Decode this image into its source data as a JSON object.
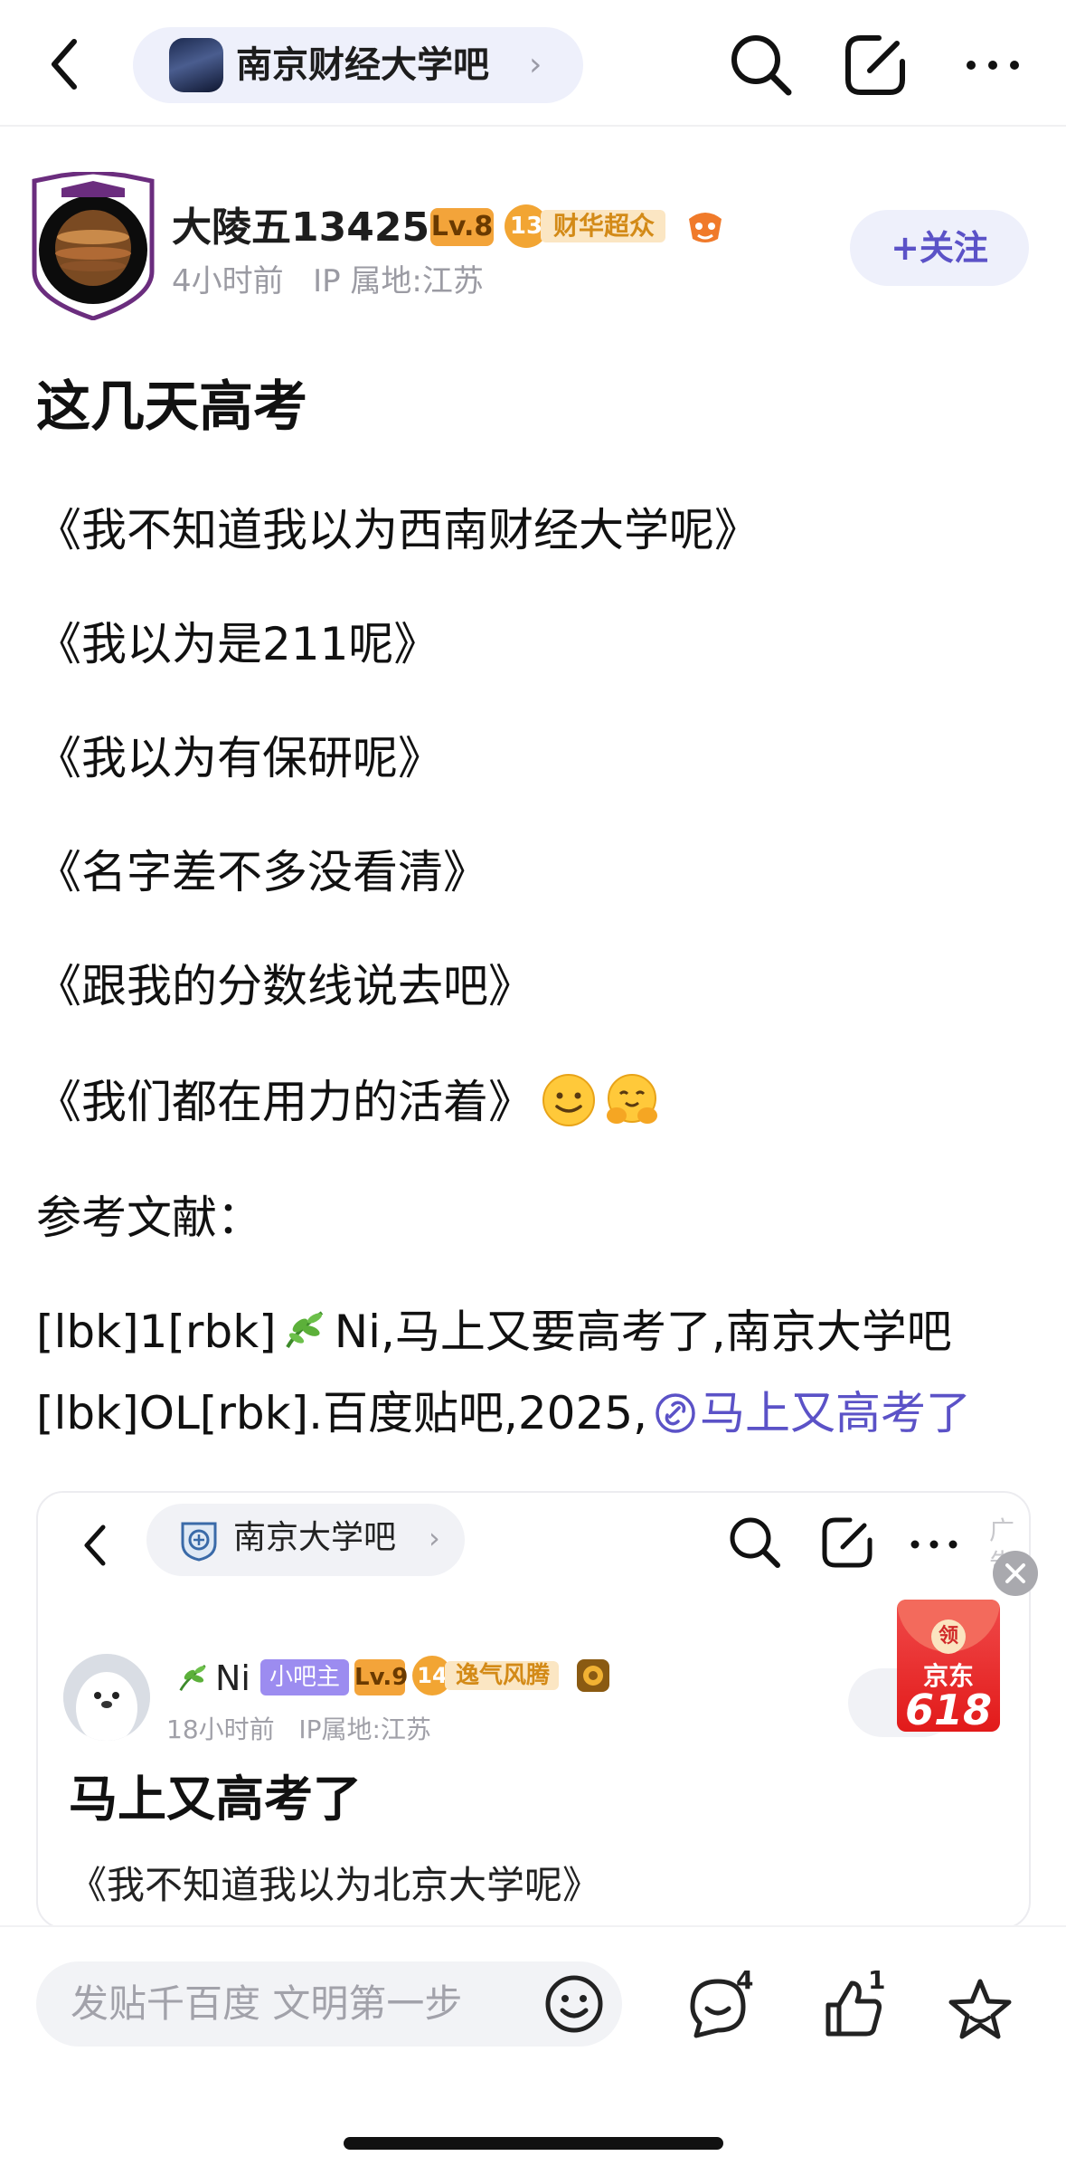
{
  "nav": {
    "forum_name": "南京财经大学吧",
    "chevron": "›"
  },
  "author": {
    "name": "大陵五13425",
    "level": "Lv.8",
    "medal_level": "13",
    "medal_title": "财华超众",
    "post_time": "4小时前",
    "ip_location": "IP 属地:江苏",
    "follow_label": "+关注"
  },
  "post": {
    "title": "这几天高考",
    "lines": [
      "《我不知道我以为西南财经大学呢》",
      "《我以为是211呢》",
      "《我以为有保研呢》",
      "《名字差不多没看清》",
      "《跟我的分数线说去吧》",
      "《我们都在用力的活着》"
    ],
    "references_heading": "参考文献：",
    "ref_line1_a": "[lbk]1[rbk]",
    "ref_line1_b": "Ni,马上又要高考了,南京大学吧",
    "ref_line2_a": "[lbk]OL[rbk].百度贴吧,2025,",
    "ref_link": "马上又高考了"
  },
  "embedded": {
    "forum_name": "南京大学吧",
    "chevron": "›",
    "ad_label": "广告",
    "author_name": "Ni",
    "moderator_tag": "小吧主",
    "level": "Lv.9",
    "medal_level": "14",
    "medal_title": "逸气风腾",
    "post_time": "18小时前",
    "ip_location": "IP属地:江苏",
    "title": "马上又高考了",
    "body_preview": "《我不知道我以为北京大学呢》"
  },
  "ad": {
    "coin": "领",
    "brand": "京东",
    "promo": "618"
  },
  "bottom": {
    "reply_placeholder": "发贴千百度 文明第一步",
    "comment_count": "4",
    "like_count": "1"
  },
  "colors": {
    "accent": "#5b52c7",
    "pill_bg": "#eef0fb",
    "level_badge": "#f3a43a",
    "medal_gold": "#f2a533",
    "ad_red": "#e21a1a"
  },
  "icons": [
    "back-arrow-icon",
    "search-icon",
    "edit-icon",
    "more-icon",
    "link-icon",
    "smiley-icon",
    "comment-icon",
    "like-icon",
    "star-icon",
    "close-icon"
  ]
}
